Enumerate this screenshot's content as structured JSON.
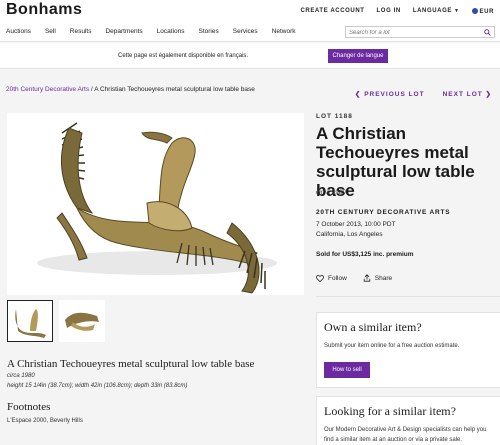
{
  "header": {
    "logo": "Bonhams",
    "create_account": "CREATE ACCOUNT",
    "login": "LOG IN",
    "language": "LANGUAGE",
    "currency": "EUR"
  },
  "nav": {
    "items": [
      "Auctions",
      "Sell",
      "Results",
      "Departments",
      "Locations",
      "Stories",
      "Services",
      "Network"
    ],
    "search_placeholder": "Search for a lot"
  },
  "language_banner": {
    "text": "Cette page est également disponible en français.",
    "button": "Changer de langue"
  },
  "breadcrumb": {
    "category": "20th Century Decorative Arts",
    "separator": "/",
    "current": "A Christian Techoueyres metal sculptural low table base"
  },
  "lot_nav": {
    "previous": "PREVIOUS LOT",
    "next": "NEXT LOT"
  },
  "lot": {
    "number": "LOT 1188",
    "title": "A Christian Techoueyres metal sculptural low table base",
    "circa": "circa 1980",
    "department": "20TH CENTURY DECORATIVE ARTS",
    "date": "7 October 2013, 10:00 PDT",
    "location": "California, Los Angeles",
    "sold": "Sold for US$3,125 inc. premium",
    "follow": "Follow",
    "share": "Share"
  },
  "details": {
    "title": "A Christian Techoueyres metal sculptural low table base",
    "circa": "circa 1980",
    "dimensions": "height 15 1/4in (38.7cm); width 42in (106.8cm); depth 33in (83.8cm)",
    "footnotes_heading": "Footnotes",
    "footnote": "L'Espace 2000, Beverly Hills"
  },
  "card_own": {
    "heading": "Own a similar item?",
    "text": "Submit your item online for a free auction estimate.",
    "button": "How to sell"
  },
  "card_looking": {
    "heading": "Looking for a similar item?",
    "text": "Our Modern Decorative Art & Design specialists can help you find a similar item at an auction or via a private sale."
  },
  "colors": {
    "accent": "#6b2aa0",
    "background": "#f4f4f4"
  }
}
